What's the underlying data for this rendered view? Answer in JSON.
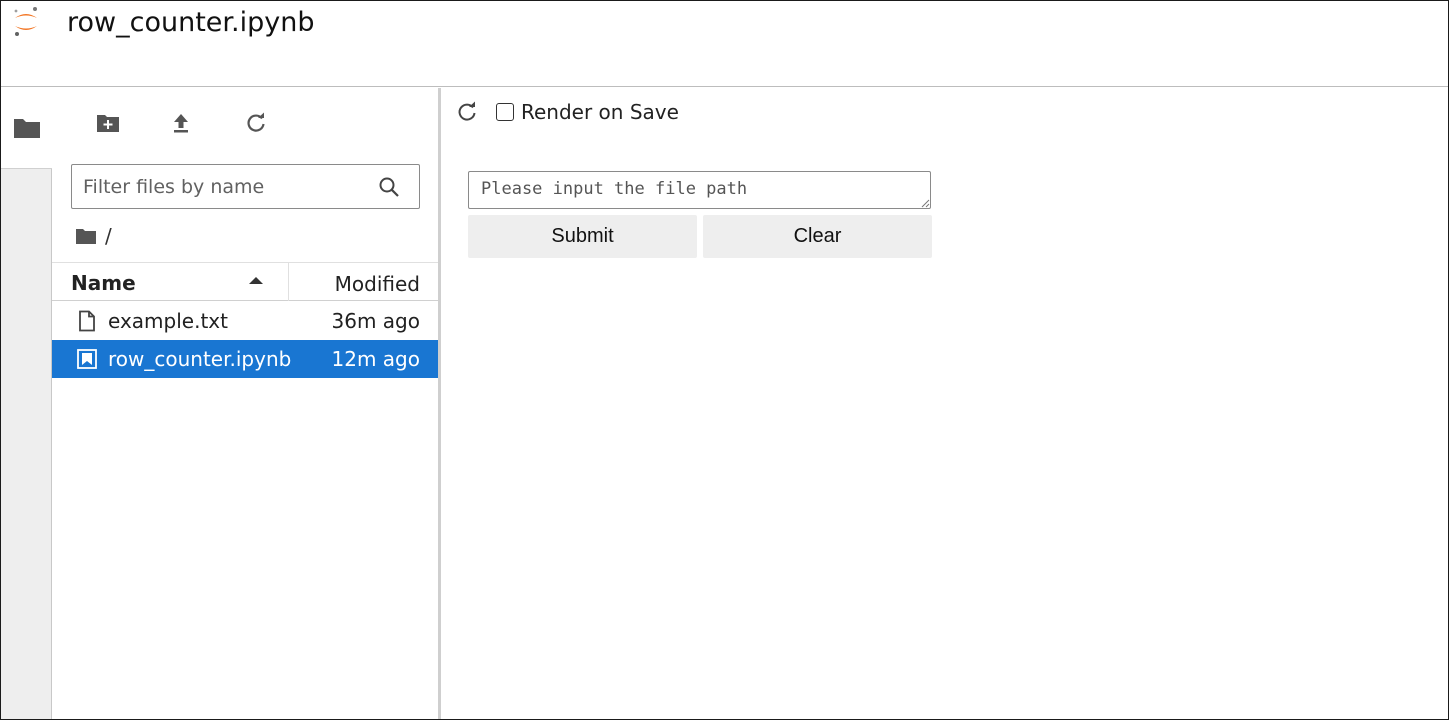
{
  "header": {
    "document_title": "row_counter.ipynb",
    "logo_icon": "jupyter-logo-icon",
    "logo_color": "#f37726"
  },
  "rail": {
    "tabs": [
      {
        "icon": "folder-icon",
        "active": true
      }
    ]
  },
  "file_browser": {
    "toolbar": [
      {
        "icon": "new-folder-icon"
      },
      {
        "icon": "upload-icon"
      },
      {
        "icon": "refresh-icon"
      }
    ],
    "filter": {
      "placeholder": "Filter files by name",
      "value": "",
      "icon": "search-icon"
    },
    "breadcrumb": {
      "icon": "folder-icon",
      "path": "/"
    },
    "columns": {
      "name": "Name",
      "modified": "Modified",
      "sort": "ascending"
    },
    "files": [
      {
        "name": "example.txt",
        "modified": "36m ago",
        "icon": "file-icon",
        "selected": false
      },
      {
        "name": "row_counter.ipynb",
        "modified": "12m ago",
        "icon": "notebook-icon",
        "selected": true
      }
    ],
    "selection_color": "#1976d2"
  },
  "main": {
    "toolbar": {
      "reload_icon": "refresh-icon",
      "render_on_save_label": "Render on Save",
      "render_on_save_checked": false
    },
    "form": {
      "path_placeholder": "Please input the file path",
      "path_value": "",
      "submit_label": "Submit",
      "clear_label": "Clear"
    }
  }
}
